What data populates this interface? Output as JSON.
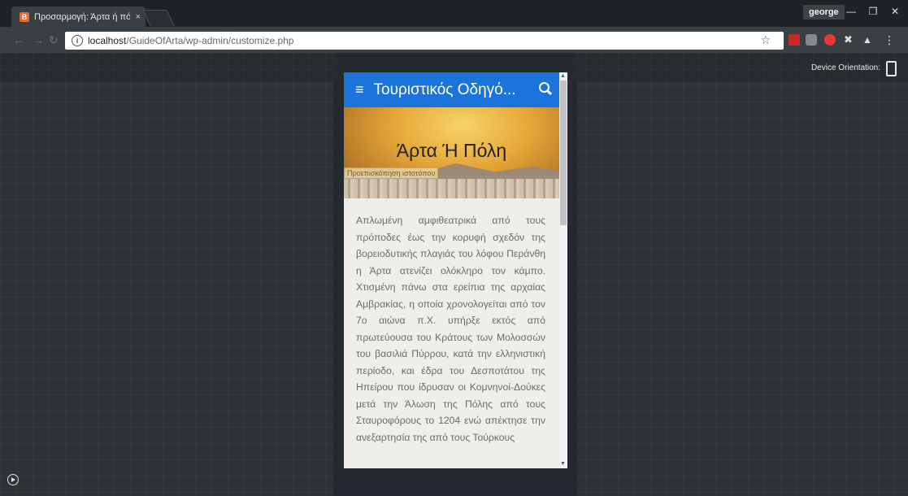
{
  "browser": {
    "tab_title": "Προσαρμογή: Άρτα ή πό",
    "tab_close": "×",
    "profile_name": "george",
    "url_host": "localhost",
    "url_path": "/GuideOfArta/wp-admin/customize.php"
  },
  "customizer": {
    "device_orientation_label": "Device Orientation:"
  },
  "site": {
    "title": "Τουριστικός Οδηγό...",
    "hero_title": "Άρτα Ή Πόλη",
    "preview_badge": "Προεπισκόπηση ιστοτόπου",
    "body_text": "Απλωμένη αμφιθεατρικά από τους πρόποδες έως την κορυφή σχεδόν της βορειοδυτικής πλαγιάς του λόφου Περάνθη η Άρτα ατενίζει ολόκληρο τον κάμπο. Χτισμένη πάνω στα ερείπια της αρχαίας Αμβρακίας, η οποία χρονολογείται από τον 7ο αιώνα π.Χ. υπήρξε εκτός από πρωτεύουσα του Κράτους των Μολοσσών του βασιλιά Πύρρου, κατά την ελληνιστική περίοδο, και έδρα του Δεσποτάτου της Ηπείρου που ίδρυσαν οι Κομνηνοί-Δούκες μετά την Άλωση της Πόλης από τους Σταυροφόρους το 1204 ενώ απέκτησε την ανεξαρτησία της από τους Τούρκους"
  },
  "colors": {
    "header_blue": "#1a74dc",
    "chrome_dark": "#1f2326"
  }
}
